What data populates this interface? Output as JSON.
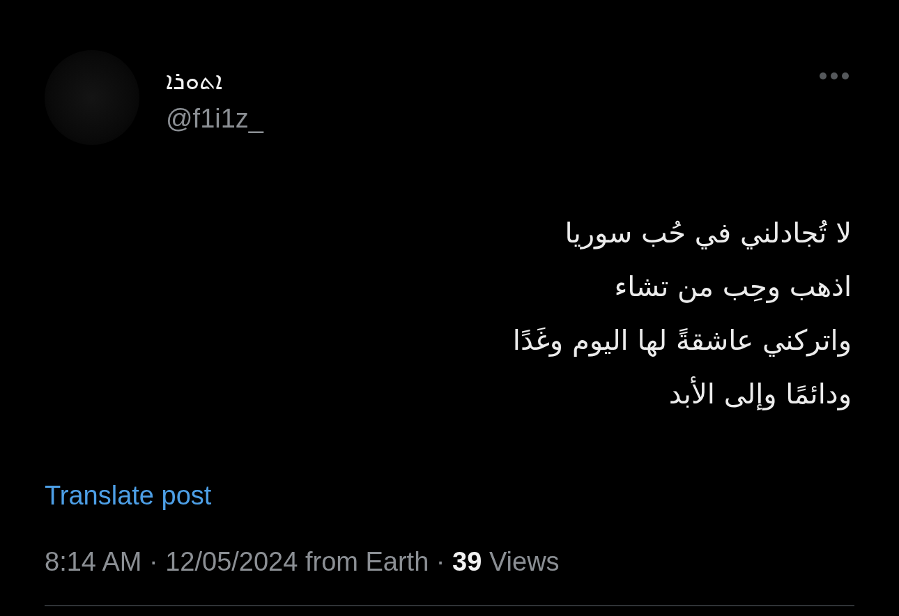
{
  "author": {
    "display_name": "ܐܬܘܪܐ",
    "handle": "@f1i1z_"
  },
  "post": {
    "text": "لا تُجادلني في حُب سوريا\nاذهب وحِب من تشاء\nواتركني عاشقةً لها اليوم وغَدًا\nودائمًا وإلى الأبد",
    "translate_link": "Translate post",
    "meta": "8:14 AM · 12/05/2024 from Earth · **39** Views"
  }
}
